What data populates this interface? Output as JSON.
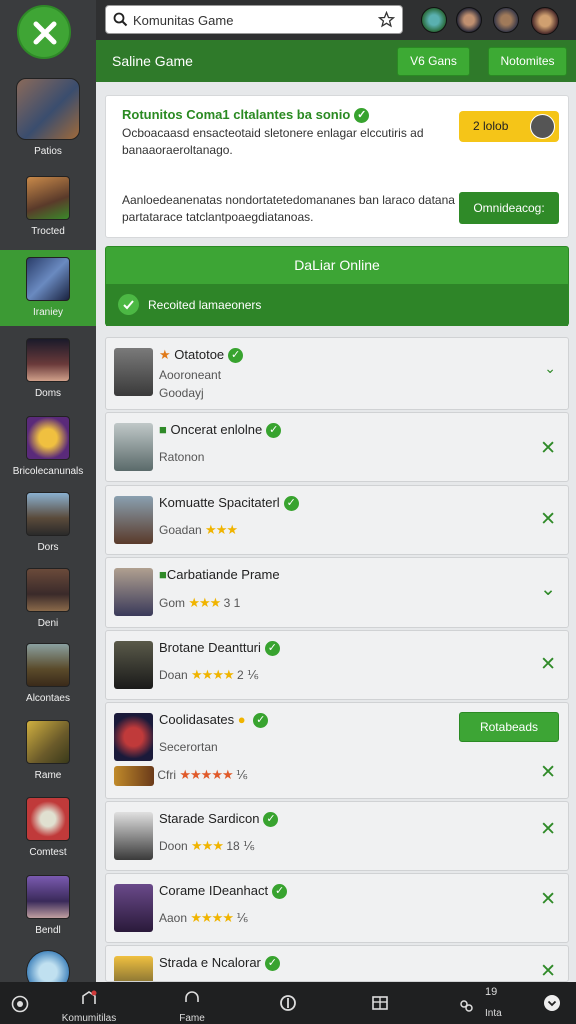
{
  "header": {
    "search_value": "Komunitas Game",
    "search_icon": "search-icon",
    "star_icon": "star-icon"
  },
  "subbar": {
    "title": "Saline Game",
    "btn1": "V6 Gans",
    "btn2": "Notomites"
  },
  "sidebar": {
    "items": [
      {
        "label": "Patios"
      },
      {
        "label": "Trocted"
      },
      {
        "label": "Iraniey"
      },
      {
        "label": "Doms"
      },
      {
        "label": "Bricolecanunals"
      },
      {
        "label": "Dors"
      },
      {
        "label": "Deni"
      },
      {
        "label": "Alcontaes"
      },
      {
        "label": "Rame"
      },
      {
        "label": "Comtest"
      },
      {
        "label": "Bendl"
      }
    ]
  },
  "banner": {
    "heading": "Rotunitos Coma1 cltalantes ba sonio",
    "text1": "Ocboacaasd ensacteotaid sletonere enlagar elccutiris ad banaaoraeroltanago.",
    "text2": "Aanloedeanenatas nondortatetedomananes ban laraco datana partatarace tatclantpoaegdiatanoas.",
    "yellow_btn": "2 lolob",
    "green_btn": "Omnideacog:"
  },
  "online": {
    "title": "DaLiar Online",
    "sub": "Recoited lamaeoners"
  },
  "games": [
    {
      "name": "Otatotoe",
      "sub": "Aooroneant",
      "sub2": "Goodayj",
      "stars": "",
      "rating": ""
    },
    {
      "name": "Oncerat enlolne",
      "sub": "Ratonon",
      "sub2": "",
      "stars": "",
      "rating": ""
    },
    {
      "name": "Komuatte Spacitaterl",
      "sub": "Goadan",
      "sub2": "",
      "stars": "★★★",
      "rating": ""
    },
    {
      "name": "Carbatiande Prame",
      "sub": "Gom",
      "sub2": "",
      "stars": "★★★",
      "rating": "3  1"
    },
    {
      "name": "Brotane Deantturi",
      "sub": "Doan",
      "sub2": "",
      "stars": "★★★★",
      "rating": "2 ⅙"
    },
    {
      "name": "Coolidasates",
      "sub": "Secerortan",
      "sub2": "Cfri",
      "stars": "★★★★★",
      "rating": "⅙",
      "button": "Rotabeads"
    },
    {
      "name": "Starade Sardicon",
      "sub": "Doon",
      "sub2": "",
      "stars": "★★★",
      "rating": "18 ⅙"
    },
    {
      "name": "Corame IDeanhact",
      "sub": "Aaon",
      "sub2": "",
      "stars": "★★★★",
      "rating": "⅙"
    },
    {
      "name": "Strada e Ncalorar",
      "sub": "",
      "sub2": "",
      "stars": "",
      "rating": ""
    }
  ],
  "bottom_nav": [
    {
      "label": "",
      "icon": "help-icon"
    },
    {
      "label": "Komumitilas",
      "icon": "community-icon"
    },
    {
      "label": "Fame",
      "icon": "headset-icon"
    },
    {
      "label": "",
      "icon": "shield-icon"
    },
    {
      "label": "",
      "icon": "grid-icon"
    },
    {
      "label": "Inta",
      "icon": "people-icon",
      "count": "19"
    },
    {
      "label": "",
      "icon": "chevron-down-icon"
    }
  ]
}
